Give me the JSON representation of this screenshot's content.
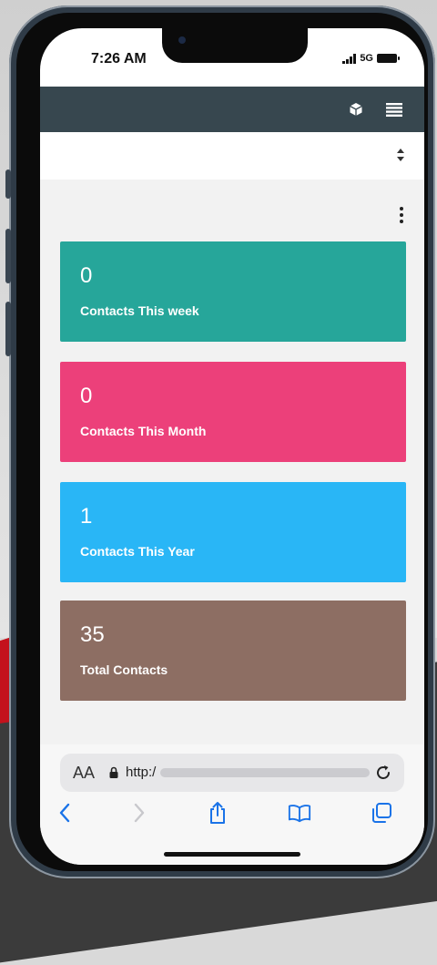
{
  "status_bar": {
    "time": "7:26 AM",
    "network": "5G"
  },
  "toolbar": {
    "icons": [
      "cube-icon",
      "menu-icon"
    ]
  },
  "content": {
    "cards": [
      {
        "value": "0",
        "label": "Contacts This week",
        "color": "#26a69a"
      },
      {
        "value": "0",
        "label": "Contacts This Month",
        "color": "#ec407a"
      },
      {
        "value": "1",
        "label": "Contacts This Year",
        "color": "#29b6f6"
      },
      {
        "value": "35",
        "label": "Total Contacts",
        "color": "#8d6e63"
      }
    ]
  },
  "browser": {
    "text_size_label": "AA",
    "url": "http:/"
  },
  "colors": {
    "appbar": "#37474f",
    "content_bg": "#f2f2f2",
    "ios_blue": "#1a73e8"
  }
}
